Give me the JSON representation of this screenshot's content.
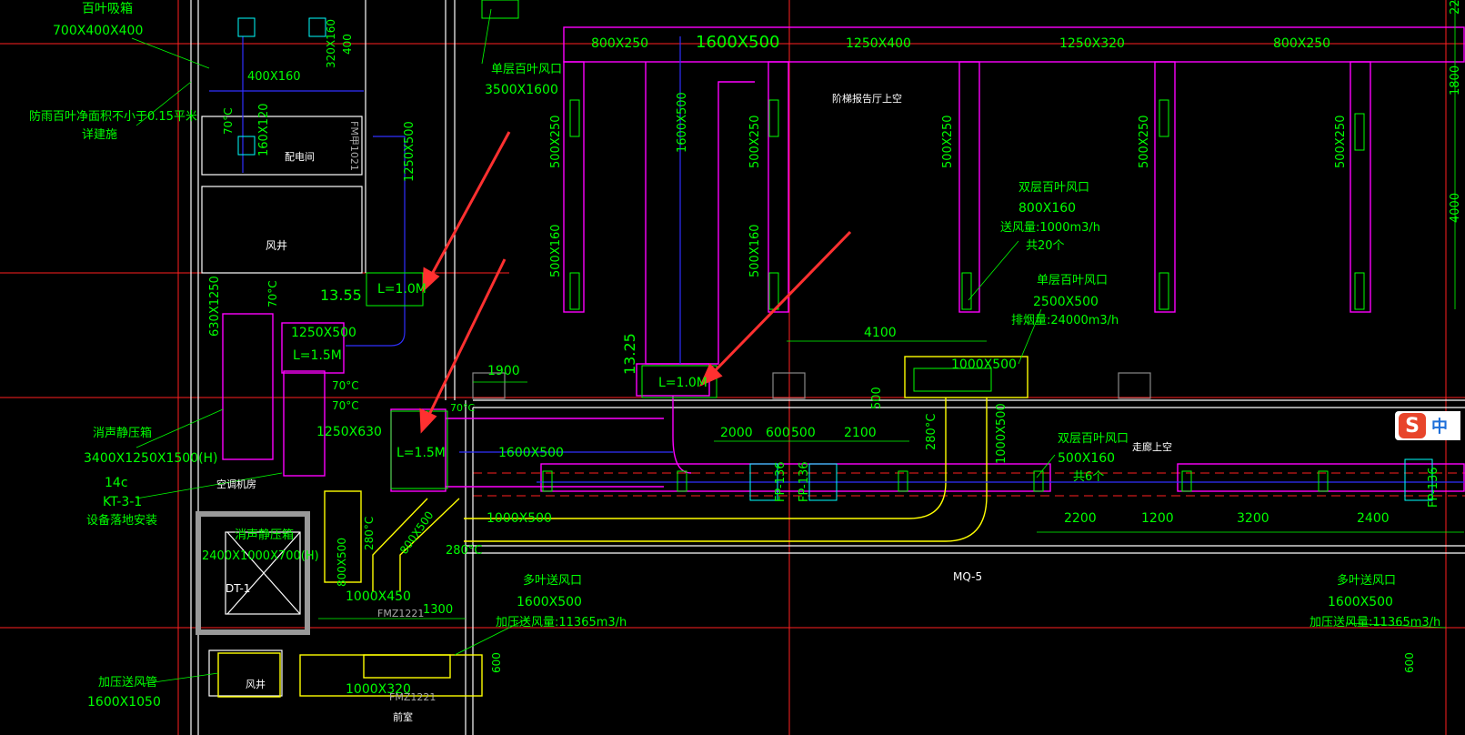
{
  "colors": {
    "background": "#000000",
    "grid_red": "#ff2020",
    "text_green": "#00ff00",
    "duct_magenta": "#ff00ff",
    "duct_yellow": "#ffff00",
    "wall_white": "#ffffff",
    "pipe_blue": "#3030ff",
    "annotation_arrow": "#ff3030"
  },
  "texts": [
    {
      "id": "louver-title",
      "text": "百叶吸箱"
    },
    {
      "id": "louver-size",
      "text": "700X400X400"
    },
    {
      "id": "louver-note1",
      "text": "防雨百叶净面积不小于0.15平米"
    },
    {
      "id": "louver-note2",
      "text": "详建施"
    },
    {
      "id": "dim-400x160",
      "text": "400X160"
    },
    {
      "id": "dim-320x160",
      "text": "320X160"
    },
    {
      "id": "dim-400",
      "text": "400"
    },
    {
      "id": "dim-160x120",
      "text": "160X120"
    },
    {
      "id": "dim-70c-a",
      "text": "70°C"
    },
    {
      "id": "room-power",
      "text": "配电间"
    },
    {
      "id": "room-fmm",
      "text": "FM甲1021"
    },
    {
      "id": "dim-1250x500-v",
      "text": "1250X500"
    },
    {
      "id": "room-shaft1",
      "text": "风井"
    },
    {
      "id": "dim-630x1250",
      "text": "630X1250"
    },
    {
      "id": "dim-70c-b",
      "text": "70°C"
    },
    {
      "id": "elev-1355",
      "text": "13.55"
    },
    {
      "id": "l10-a",
      "text": "L=1.0M"
    },
    {
      "id": "dim-1250x500-h",
      "text": "1250X500"
    },
    {
      "id": "l15-a",
      "text": "L=1.5M"
    },
    {
      "id": "dim-70c-c",
      "text": "70°C"
    },
    {
      "id": "dim-70c-d",
      "text": "70°C"
    },
    {
      "id": "dim-1250x630",
      "text": "1250X630"
    },
    {
      "id": "l15-b",
      "text": "L=1.5M"
    },
    {
      "id": "dim-1600x500-a",
      "text": "1600X500"
    },
    {
      "id": "muffler-box",
      "text": "消声静压箱"
    },
    {
      "id": "muffler-size",
      "text": "3400X1250X1500(H)"
    },
    {
      "id": "equip-14c",
      "text": "14c"
    },
    {
      "id": "equip-kt",
      "text": "KT-3-1"
    },
    {
      "id": "equip-note",
      "text": "设备落地安装"
    },
    {
      "id": "room-ahu",
      "text": "空调机房"
    },
    {
      "id": "muffler2",
      "text": "消声静压箱"
    },
    {
      "id": "muffler2-size",
      "text": "2400X1000X700(H)"
    },
    {
      "id": "room-dt1",
      "text": "DT-1"
    },
    {
      "id": "dim-800x500",
      "text": "800X500"
    },
    {
      "id": "dim-280c-a",
      "text": "280°C"
    },
    {
      "id": "dim-800x500-b",
      "text": "800X500"
    },
    {
      "id": "dim-280c-b",
      "text": "280°C"
    },
    {
      "id": "dim-1000x450",
      "text": "1000X450"
    },
    {
      "id": "room-fmz1",
      "text": "FMZ1221"
    },
    {
      "id": "dim-1300",
      "text": "1300"
    },
    {
      "id": "dim-1000x500-a",
      "text": "1000X500"
    },
    {
      "id": "single-louver-a",
      "text": "单层百叶风口"
    },
    {
      "id": "single-louver-a-size",
      "text": "3500X1600"
    },
    {
      "id": "dim-800x250-a",
      "text": "800X250"
    },
    {
      "id": "dim-1600x500-top",
      "text": "1600X500"
    },
    {
      "id": "dim-1250x400",
      "text": "1250X400"
    },
    {
      "id": "dim-1250x320",
      "text": "1250X320"
    },
    {
      "id": "dim-800x250-b",
      "text": "800X250"
    },
    {
      "id": "dim-22",
      "text": "22"
    },
    {
      "id": "dim-1800",
      "text": "1800"
    },
    {
      "id": "dim-4000",
      "text": "4000"
    },
    {
      "id": "room-hall",
      "text": "阶梯报告厅上空"
    },
    {
      "id": "dim-500x250-a",
      "text": "500X250"
    },
    {
      "id": "dim-1600x500-v",
      "text": "1600X500"
    },
    {
      "id": "dim-500x250-b",
      "text": "500X250"
    },
    {
      "id": "dim-500x250-c",
      "text": "500X250"
    },
    {
      "id": "dim-500x250-d",
      "text": "500X250"
    },
    {
      "id": "dim-500x250-e",
      "text": "500X250"
    },
    {
      "id": "dim-500x160-a",
      "text": "500X160"
    },
    {
      "id": "dim-500x160-b",
      "text": "500X160"
    },
    {
      "id": "double-louver-a",
      "text": "双层百叶风口"
    },
    {
      "id": "double-louver-a-size",
      "text": "800X160"
    },
    {
      "id": "double-louver-a-flow",
      "text": "送风量:1000m3/h"
    },
    {
      "id": "double-louver-a-count",
      "text": "共20个"
    },
    {
      "id": "single-louver-b",
      "text": "单层百叶风口"
    },
    {
      "id": "single-louver-b-size",
      "text": "2500X500"
    },
    {
      "id": "single-louver-b-flow",
      "text": "排烟量:24000m3/h"
    },
    {
      "id": "dim-4100",
      "text": "4100"
    },
    {
      "id": "elev-1325",
      "text": "13.25"
    },
    {
      "id": "l10-b",
      "text": "L=1.0M"
    },
    {
      "id": "dim-1000x500-b",
      "text": "1000X500"
    },
    {
      "id": "dim-500-v",
      "text": "500"
    },
    {
      "id": "dim-1900",
      "text": "1900"
    },
    {
      "id": "dim-70c-e",
      "text": "70°C"
    },
    {
      "id": "dim-280c-c",
      "text": "280°C"
    },
    {
      "id": "dim-1000x500-v",
      "text": "1000X500"
    },
    {
      "id": "dim-2000",
      "text": "2000"
    },
    {
      "id": "dim-600",
      "text": "600"
    },
    {
      "id": "dim-500",
      "text": "500"
    },
    {
      "id": "dim-2100",
      "text": "2100"
    },
    {
      "id": "fp-136-a",
      "text": "FP-136"
    },
    {
      "id": "fp-136-b",
      "text": "FP-136"
    },
    {
      "id": "fp-136-c",
      "text": "FP-136"
    },
    {
      "id": "double-louver-b",
      "text": "双层百叶风口"
    },
    {
      "id": "double-louver-b-size",
      "text": "500X160"
    },
    {
      "id": "double-louver-b-count",
      "text": "共6个"
    },
    {
      "id": "room-corridor",
      "text": "走廊上空"
    },
    {
      "id": "dim-2200",
      "text": "2200"
    },
    {
      "id": "dim-1200",
      "text": "1200"
    },
    {
      "id": "dim-3200",
      "text": "3200"
    },
    {
      "id": "dim-2400",
      "text": "2400"
    },
    {
      "id": "mq5",
      "text": "MQ-5"
    },
    {
      "id": "multi-louver-a",
      "text": "多叶送风口"
    },
    {
      "id": "multi-louver-a-size",
      "text": "1600X500"
    },
    {
      "id": "multi-louver-a-flow",
      "text": "加压送风量:11365m3/h"
    },
    {
      "id": "multi-louver-b",
      "text": "多叶送风口"
    },
    {
      "id": "multi-louver-b-size",
      "text": "1600X500"
    },
    {
      "id": "multi-louver-b-flow",
      "text": "加压送风量:11365m3/h"
    },
    {
      "id": "dim-600-a",
      "text": "600"
    },
    {
      "id": "dim-600-b",
      "text": "600"
    },
    {
      "id": "press-duct",
      "text": "加压送风管"
    },
    {
      "id": "press-duct-size",
      "text": "1600X1050"
    },
    {
      "id": "room-shaft2",
      "text": "风井"
    },
    {
      "id": "dim-1000x320",
      "text": "1000X320"
    },
    {
      "id": "room-fmz2",
      "text": "FMZ1221"
    },
    {
      "id": "room-front",
      "text": "前室"
    }
  ],
  "ime": {
    "logo": "S",
    "mode": "中"
  }
}
